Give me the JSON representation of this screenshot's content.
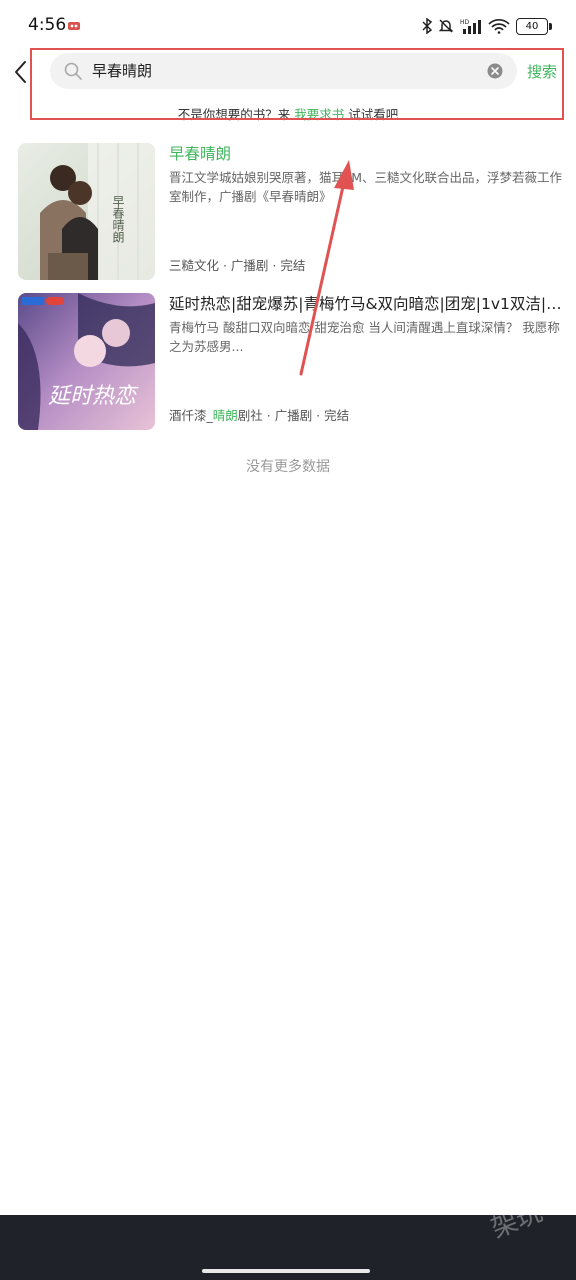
{
  "status_bar": {
    "time": "4:56",
    "battery": "40"
  },
  "search": {
    "query": "早春晴朗",
    "button_label": "搜索"
  },
  "hint": {
    "prefix": "不是你想要的书？来 ",
    "link": "我要求书",
    "suffix": " 试试看吧"
  },
  "results": [
    {
      "title": "早春晴朗",
      "description": "晋江文学城姑娘别哭原著，猫耳FM、三糙文化联合出品，浮梦若薇工作室制作，广播剧《早春晴朗》",
      "meta_plain": "三糙文化 · 广播剧 · 完结",
      "cover_text": "早春晴朗"
    },
    {
      "title": "延时热恋|甜宠爆苏|青梅竹马&双向暗恋|团宠|1v1双洁|VI...",
      "description": "青梅竹马 酸甜口双向暗恋 甜宠治愈 当人间清醒遇上直球深情？ 我愿称之为苏感男...",
      "meta_pre": "酒仟漆_",
      "meta_hl": "晴朗",
      "meta_post": "剧社 · 广播剧 · 完结",
      "cover_text": "延时热恋"
    }
  ],
  "footer": {
    "no_more": "没有更多数据"
  },
  "watermark": "架玩",
  "colors": {
    "accent": "#3fb65c",
    "annotation": "#e15353",
    "navbar": "#1f2329"
  }
}
